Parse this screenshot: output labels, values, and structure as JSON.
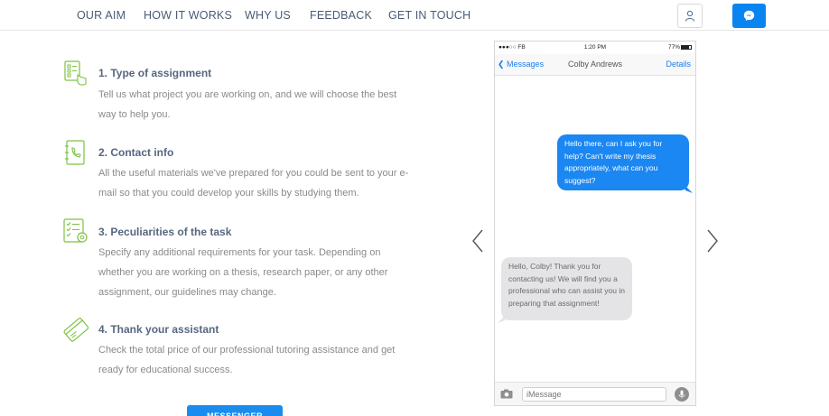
{
  "nav": {
    "links": [
      "OUR AIM",
      "HOW IT WORKS",
      "WHY US",
      "FEEDBACK",
      "GET IN TOUCH"
    ]
  },
  "steps": [
    {
      "title": "1. Type of assignment",
      "desc": "Tell us what project you are working on, and we will choose the best way to help you.",
      "icon": "checklist-hand-icon"
    },
    {
      "title": "2. Contact info",
      "desc": "All the useful materials we've prepared for you could be sent to your e-mail so that you could develop your skills by studying them.",
      "icon": "phone-book-icon"
    },
    {
      "title": "3. Peculiarities of the task",
      "desc": "Specify any additional requirements for your task. Depending on whether you are working on a thesis, research paper, or any other assignment, our guidelines may change.",
      "icon": "checklist-gear-icon"
    },
    {
      "title": "4. Thank your assistant",
      "desc": "Check the total price of our professional tutoring assistance and get ready for educational success.",
      "icon": "credit-card-icon"
    }
  ],
  "bottom_button": "MESSENGER",
  "phone": {
    "carrier": "●●●○○ FB",
    "time": "1:20 PM",
    "battery": "77%",
    "back_label": "Messages",
    "contact": "Colby Andrews",
    "details_label": "Details",
    "outgoing": "Hello there, can I ask you for help? Can't write my thesis appropriately, what can you suggest?",
    "incoming": "Hello, Colby! Thank you for contacting us! We will find you a professional who can assist you in preparing that assignment!",
    "input_placeholder": "iMessage"
  },
  "colors": {
    "accent": "#1b87f2",
    "icon_green": "#7cc242",
    "nav_text": "#4a5b74"
  }
}
